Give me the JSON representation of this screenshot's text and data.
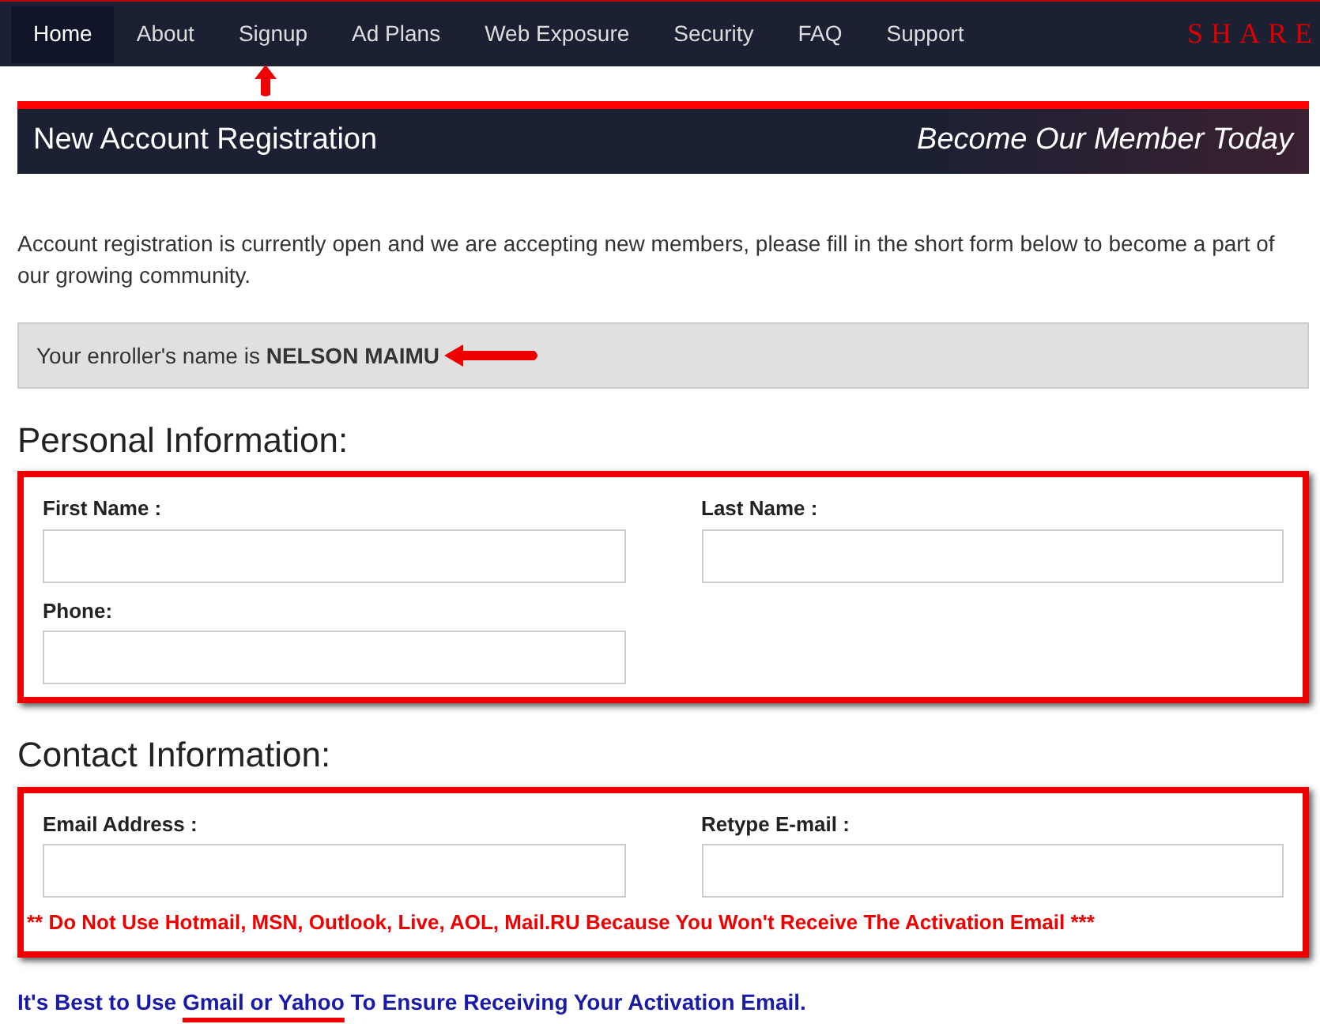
{
  "nav": {
    "items": [
      {
        "label": "Home",
        "selected": true
      },
      {
        "label": "About",
        "selected": false
      },
      {
        "label": "Signup",
        "selected": false
      },
      {
        "label": "Ad Plans",
        "selected": false
      },
      {
        "label": "Web Exposure",
        "selected": false
      },
      {
        "label": "Security",
        "selected": false
      },
      {
        "label": "FAQ",
        "selected": false
      },
      {
        "label": "Support",
        "selected": false
      }
    ],
    "brand": "SHARE"
  },
  "banner": {
    "title": "New Account Registration",
    "tagline": "Become Our Member Today"
  },
  "intro": "Account registration is currently open and we are accepting new members, please fill in the short form below to become a part of our growing community.",
  "enroller": "Your enroller's name is **NELSON MAIMU**",
  "sections": [
    {
      "title": "Personal Information:",
      "fields": [
        {
          "label": "First Name :"
        },
        {
          "label": "Last Name :"
        },
        {
          "label": "Phone:"
        }
      ]
    },
    {
      "title": "Contact Information:",
      "fields": [
        {
          "label": "Email Address :"
        },
        {
          "label": "Retype E-mail :"
        }
      ],
      "warning": "** Do Not Use Hotmail, MSN, Outlook, Live, AOL, Mail.RU Because You Won't Receive The Activation Email ***"
    }
  ],
  "tip": {
    "before": "It's Best to Use",
    "link": "Gmail or Yahoo",
    "after": "To Ensure Receiving Your Activation Email."
  }
}
